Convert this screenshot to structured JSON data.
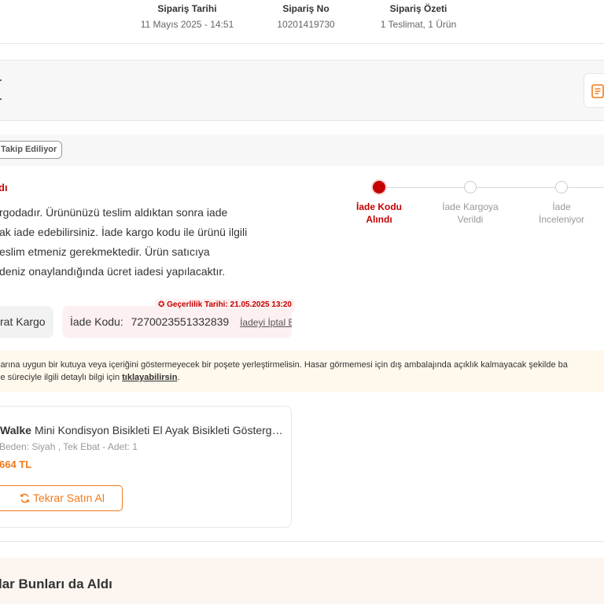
{
  "order_header": {
    "date_label": "Sipariş Tarihi",
    "date_value": "11 Mayıs 2025 - 14:51",
    "number_label": "Sipariş No",
    "number_value": "10201419730",
    "summary_label": "Sipariş Özeti",
    "summary_value": "1 Teslimat, 1 Ürün"
  },
  "status": {
    "tracking_badge": "Takip Ediliyor",
    "title": "dı",
    "description_lines": [
      "rgodadır. Ürününüzü teslim aldıktan sonra iade",
      "ak iade edebilirsiniz. İade kargo kodu ile ürünü ilgili",
      "eslim etmeniz gerekmektedir. Ürün satıcıya",
      "deniz onaylandığında ücret iadesi yapılacaktır."
    ]
  },
  "steps": [
    {
      "line1": "İade Kodu",
      "line2": "Alındı",
      "active": true
    },
    {
      "line1": "İade Kargoya",
      "line2": "Verildi",
      "active": false
    },
    {
      "line1": "İade",
      "line2": "İnceleniyor",
      "active": false
    }
  ],
  "return_code": {
    "carrier": "rat Kargo",
    "label": "İade Kodu:",
    "value": "7270023551332839",
    "cancel_link": "İadeyi İptal Et",
    "validity": "✪ Geçerlilik Tarihi: 21.05.2025 13:20"
  },
  "warning": {
    "line1": "larına uygun bir kutuya veya içeriğini göstermeyecek bir poşete yerleştirmelisin. Hasar görmemesi için dış ambalajında açıklık kalmayacak şekilde ba",
    "line2_prefix": "le süreciyle ilgili detaylı bilgi için ",
    "line2_link": "tıklayabilirsin",
    "line2_suffix": "."
  },
  "product": {
    "brand": "Walke",
    "name": "Mini Kondisyon Bisikleti El Ayak Bisikleti Gösterg…",
    "variant": "Beden: Siyah , Tek Ebat - Adet: 1",
    "price": "664 TL",
    "rebuy_label": "Tekrar Satın Al"
  },
  "suggestions": {
    "title": "lar Bunları da Aldı"
  },
  "colors": {
    "accent_red": "#c40000",
    "accent_orange": "#f27a1a",
    "warning_bg": "#fff8ec"
  }
}
